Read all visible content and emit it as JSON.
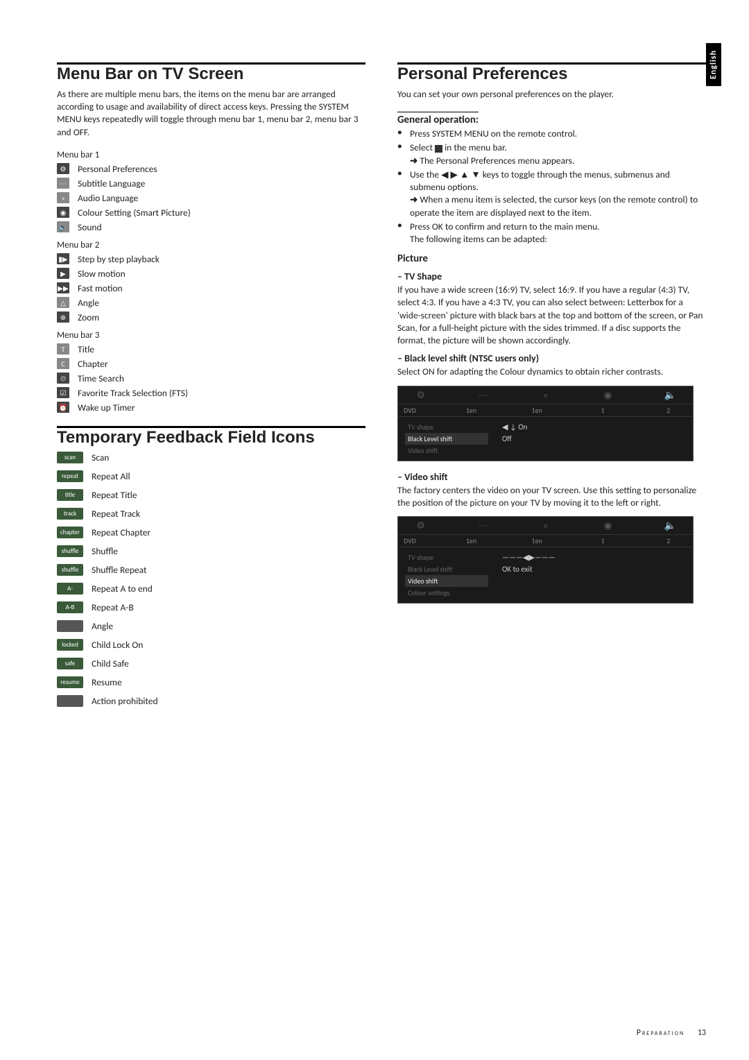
{
  "sidetab": "English",
  "left": {
    "h_menu_bar": "Menu Bar on TV Screen",
    "intro": "As there are multiple menu bars, the items on the menu bar are arranged according to usage and availability of direct access keys. Pressing the SYSTEM MENU keys repeatedly will toggle through menu bar 1, menu bar 2, menu bar 3 and OFF.",
    "menu1_title": "Menu bar 1",
    "menu1": [
      "Personal Preferences",
      "Subtitle Language",
      "Audio Language",
      "Colour Setting (Smart Picture)",
      "Sound"
    ],
    "menu2_title": "Menu bar 2",
    "menu2": [
      "Step by step playback",
      "Slow motion",
      "Fast motion",
      "Angle",
      "Zoom"
    ],
    "menu3_title": "Menu bar 3",
    "menu3": [
      "Title",
      "Chapter",
      "Time Search",
      "Favorite Track Selection (FTS)",
      "Wake up Timer"
    ],
    "h_feedback": "Temporary Feedback Field Icons",
    "feedback": [
      {
        "tag": "scan",
        "label": "Scan"
      },
      {
        "tag": "repeat",
        "label": "Repeat All"
      },
      {
        "tag": "title",
        "label": "Repeat Title"
      },
      {
        "tag": "track",
        "label": "Repeat Track"
      },
      {
        "tag": "chapter",
        "label": "Repeat Chapter"
      },
      {
        "tag": "shuffle",
        "label": "Shuffle"
      },
      {
        "tag": "shuffle",
        "label": "Shuffle Repeat"
      },
      {
        "tag": "A-",
        "label": "Repeat A to end"
      },
      {
        "tag": "A-B",
        "label": "Repeat A-B"
      },
      {
        "tag": "",
        "label": "Angle",
        "gray": true
      },
      {
        "tag": "locked",
        "label": "Child Lock On"
      },
      {
        "tag": "safe",
        "label": "Child Safe"
      },
      {
        "tag": "resume",
        "label": "Resume"
      },
      {
        "tag": "",
        "label": "Action prohibited",
        "gray": true
      }
    ]
  },
  "right": {
    "h_personal": "Personal Preferences",
    "intro": "You can set your own personal preferences on the player.",
    "h_general": "General operation:",
    "bul1": "Press SYSTEM MENU on the remote control.",
    "bul2a": "Select ",
    "bul2b": " in the menu bar.",
    "arr1": "The Personal Preferences menu appears.",
    "bul3": "Use the ◀ ▶ ▲ ▼ keys to toggle through the menus, submenus and submenu options.",
    "arr2": "When a menu item is selected, the cursor keys (on the remote control) to operate the item are displayed next to the item.",
    "bul4a": "Press OK to confirm and return to the main menu.",
    "bul4b": "The following items can be adapted:",
    "h_picture": "Picture",
    "h_tvshape": "– TV Shape",
    "tvshape_text": "If you have a wide screen (16:9) TV, select 16:9. If you have a regular (4:3) TV, select 4:3. If you have a 4:3 TV, you can also select between: Letterbox for a 'wide-screen' picture with black bars at the top and bottom of the screen, or Pan Scan, for a full-height picture with the sides trimmed. If a disc supports the format, the picture will be shown accordingly.",
    "h_black": "– Black level shift (NTSC users only)",
    "black_text": "Select ON for adapting the Colour dynamics to obtain richer contrasts.",
    "mock1": {
      "row2": [
        "1en",
        "1en",
        "1",
        "2"
      ],
      "left": [
        "TV shape",
        "Black Level shift",
        "Video shift"
      ],
      "active_idx": 1,
      "right": [
        "◀ ↓ On",
        "   Off"
      ]
    },
    "h_video": "– Video shift",
    "video_text": "The factory centers the video on your TV screen. Use this setting to personalize the position of the picture on your TV by moving it to the left or right.",
    "mock2": {
      "row2": [
        "1en",
        "1en",
        "1",
        "2"
      ],
      "left": [
        "TV shape",
        "Black Level shift",
        "Video shift",
        "Colour settings"
      ],
      "active_idx": 2,
      "right": [
        "———◀▶———",
        "OK to exit"
      ]
    }
  },
  "footer": {
    "section": "Preparation",
    "page": "13"
  }
}
